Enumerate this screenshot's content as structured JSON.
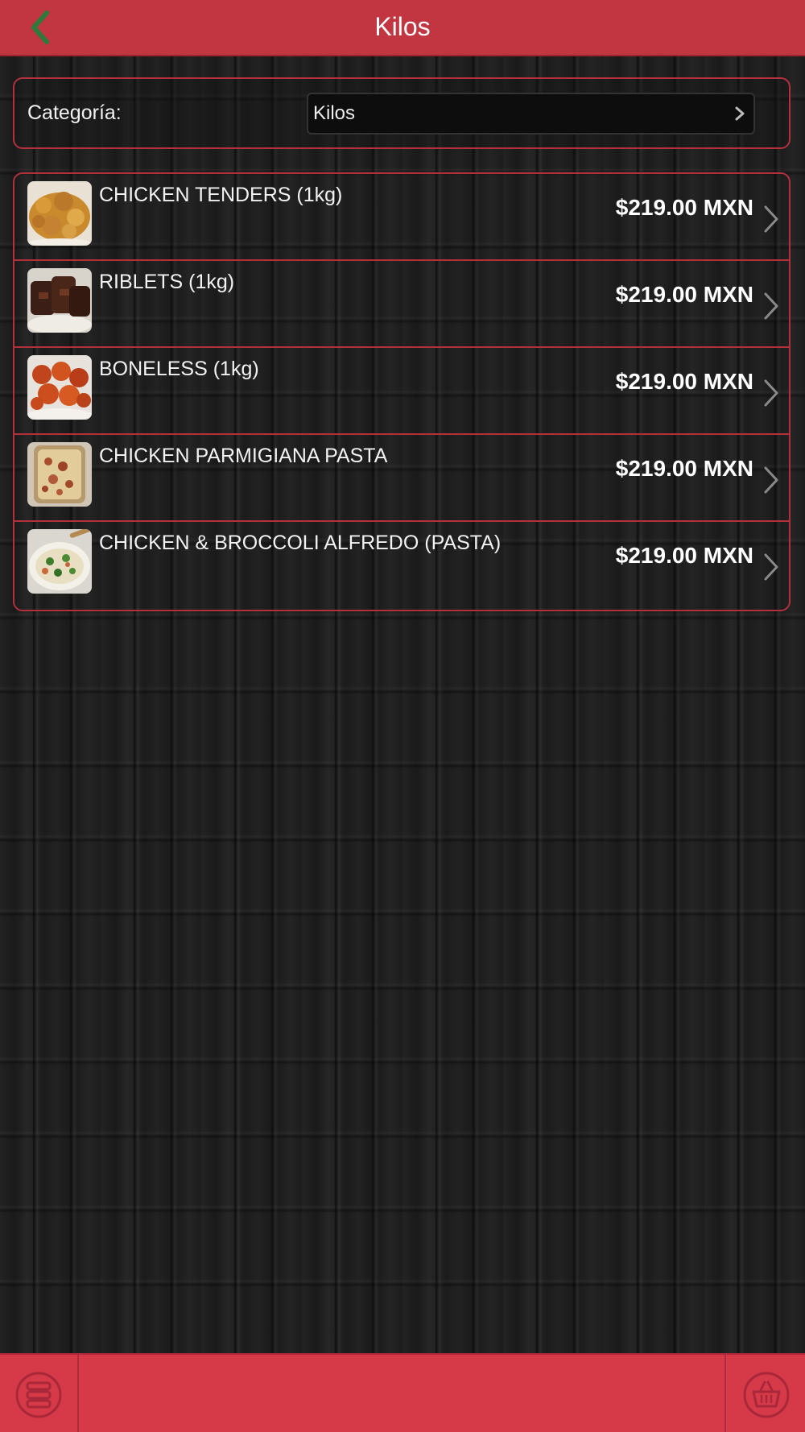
{
  "header": {
    "title": "Kilos",
    "back_icon": "chevron-left-icon",
    "back_color": "#2e7a3c",
    "bar_color": "#c23642"
  },
  "category": {
    "label": "Categoría:",
    "selected": "Kilos"
  },
  "products": [
    {
      "name": "CHICKEN TENDERS (1kg)",
      "price": "$219.00 MXN",
      "image": "chicken-tenders-photo"
    },
    {
      "name": "RIBLETS (1kg)",
      "price": "$219.00 MXN",
      "image": "riblets-photo"
    },
    {
      "name": "BONELESS (1kg)",
      "price": "$219.00 MXN",
      "image": "boneless-photo"
    },
    {
      "name": "CHICKEN PARMIGIANA PASTA",
      "price": "$219.00 MXN",
      "image": "parmigiana-pasta-photo"
    },
    {
      "name": "CHICKEN & BROCCOLI ALFREDO (PASTA)",
      "price": "$219.00 MXN",
      "image": "alfredo-pasta-photo"
    }
  ],
  "footer": {
    "left_icon": "menu-stack-icon",
    "right_icon": "basket-icon",
    "bar_color": "#d63a48"
  }
}
